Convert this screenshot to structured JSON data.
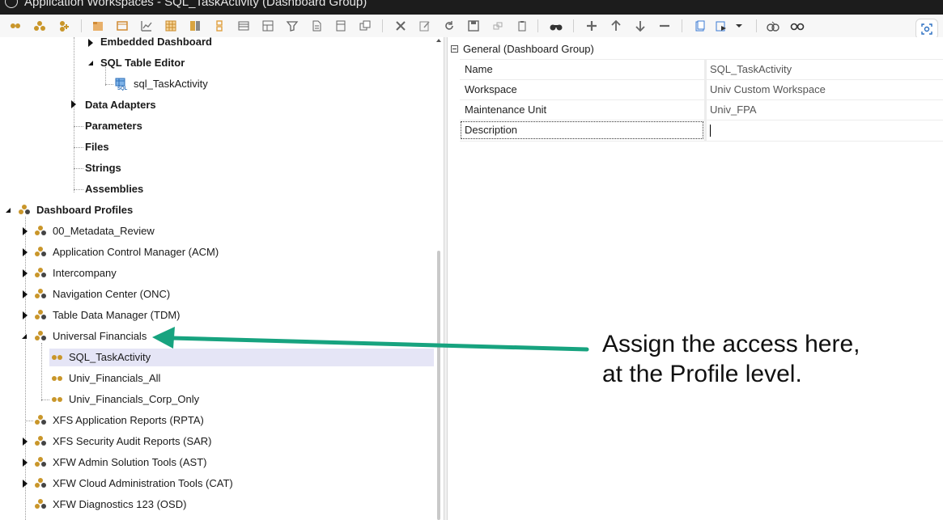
{
  "window": {
    "title": "Application Workspaces - SQL_TaskActivity (Dashboard Group)"
  },
  "toolbar": {
    "icons": [
      "group-icon",
      "create-icon",
      "add-icon",
      "folder-icon",
      "dashboard-icon",
      "chart-icon",
      "grid-icon",
      "report-icon",
      "db-icon",
      "table-icon",
      "filter-icon",
      "document-icon",
      "layout-icon",
      "copy-icon",
      "delete-icon",
      "edit-icon",
      "refresh-icon",
      "save-icon",
      "link-icon",
      "clipboard-icon",
      "binoculars-icon",
      "add-plus-icon",
      "move-up-icon",
      "move-down-icon",
      "remove-icon",
      "import-icon",
      "export-icon",
      "dropdown-icon",
      "compare-icon",
      "glasses-icon",
      "screen-capture-icon"
    ]
  },
  "tree": {
    "nodes": [
      {
        "label": "Embedded Dashboard",
        "bold": true
      },
      {
        "label": "SQL Table Editor",
        "bold": true
      },
      {
        "label": "sql_TaskActivity",
        "icon": "sql-table-icon"
      },
      {
        "label": "Data Adapters",
        "bold": true
      },
      {
        "label": "Parameters",
        "bold": true
      },
      {
        "label": "Files",
        "bold": true
      },
      {
        "label": "Strings",
        "bold": true
      },
      {
        "label": "Assemblies",
        "bold": true
      },
      {
        "label": "Dashboard Profiles",
        "bold": true
      },
      {
        "label": "00_Metadata_Review"
      },
      {
        "label": "Application Control Manager (ACM)"
      },
      {
        "label": "Intercompany"
      },
      {
        "label": "Navigation Center (ONC)"
      },
      {
        "label": "Table Data Manager (TDM)"
      },
      {
        "label": "Universal Financials"
      },
      {
        "label": "SQL_TaskActivity",
        "selected": true
      },
      {
        "label": "Univ_Financials_All"
      },
      {
        "label": "Univ_Financials_Corp_Only"
      },
      {
        "label": "XFS Application Reports (RPTA)"
      },
      {
        "label": "XFS Security Audit Reports (SAR)"
      },
      {
        "label": "XFW Admin Solution Tools (AST)"
      },
      {
        "label": "XFW Cloud Administration Tools (CAT)"
      },
      {
        "label": "XFW Diagnostics 123 (OSD)"
      }
    ]
  },
  "properties": {
    "group_label": "General (Dashboard Group)",
    "rows": [
      {
        "name": "Name",
        "value": "SQL_TaskActivity"
      },
      {
        "name": "Workspace",
        "value": "Univ Custom Workspace"
      },
      {
        "name": "Maintenance Unit",
        "value": "Univ_FPA"
      },
      {
        "name": "Description",
        "value": ""
      }
    ]
  },
  "annotation": {
    "line1": "Assign the access here,",
    "line2": "at the Profile level.",
    "arrow_color": "#17a37f"
  },
  "colors": {
    "profile_icon": "#c9962a",
    "selection": "#e5e5f6",
    "title_bar": "#1c1c1c"
  }
}
